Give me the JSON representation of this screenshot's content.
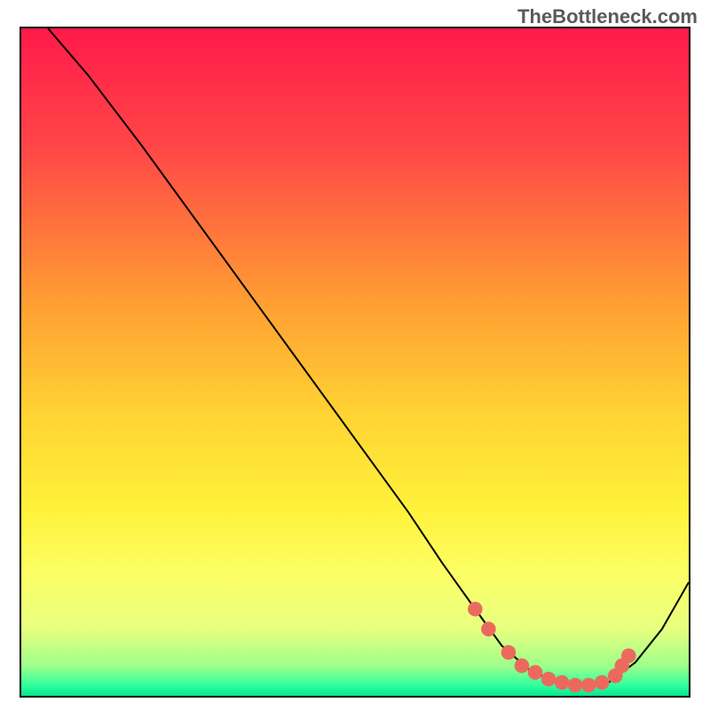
{
  "watermark": "TheBottleneck.com",
  "chart_data": {
    "type": "line",
    "title": "",
    "xlabel": "",
    "ylabel": "",
    "xlim": [
      0,
      100
    ],
    "ylim": [
      0,
      100
    ],
    "series": [
      {
        "name": "bottleneck-curve",
        "x": [
          4,
          10,
          18,
          26,
          34,
          42,
          50,
          58,
          63,
          68,
          72,
          76,
          80,
          84,
          88,
          92,
          96,
          100
        ],
        "y": [
          100,
          93,
          82.5,
          71.5,
          60.5,
          49.5,
          38.5,
          27.5,
          20,
          13,
          7.5,
          4,
          2,
          1.5,
          2,
          5,
          10,
          17
        ]
      }
    ],
    "highlight_points": {
      "name": "optimal-range-dots",
      "color": "#ec6a5d",
      "x": [
        68,
        70,
        73,
        75,
        77,
        79,
        81,
        83,
        85,
        87,
        89,
        90,
        91
      ],
      "y": [
        13,
        10,
        6.5,
        4.5,
        3.5,
        2.5,
        2,
        1.6,
        1.6,
        2,
        3,
        4.5,
        6
      ]
    },
    "gradient_stops": [
      {
        "pos": 0.0,
        "color": "#ff1a4a"
      },
      {
        "pos": 0.18,
        "color": "#ff4747"
      },
      {
        "pos": 0.4,
        "color": "#ff9a33"
      },
      {
        "pos": 0.58,
        "color": "#ffd433"
      },
      {
        "pos": 0.72,
        "color": "#fff23a"
      },
      {
        "pos": 0.82,
        "color": "#fcff66"
      },
      {
        "pos": 0.9,
        "color": "#e7ff80"
      },
      {
        "pos": 0.955,
        "color": "#9eff8a"
      },
      {
        "pos": 0.985,
        "color": "#2fff9f"
      },
      {
        "pos": 1.0,
        "color": "#06e58e"
      }
    ]
  }
}
